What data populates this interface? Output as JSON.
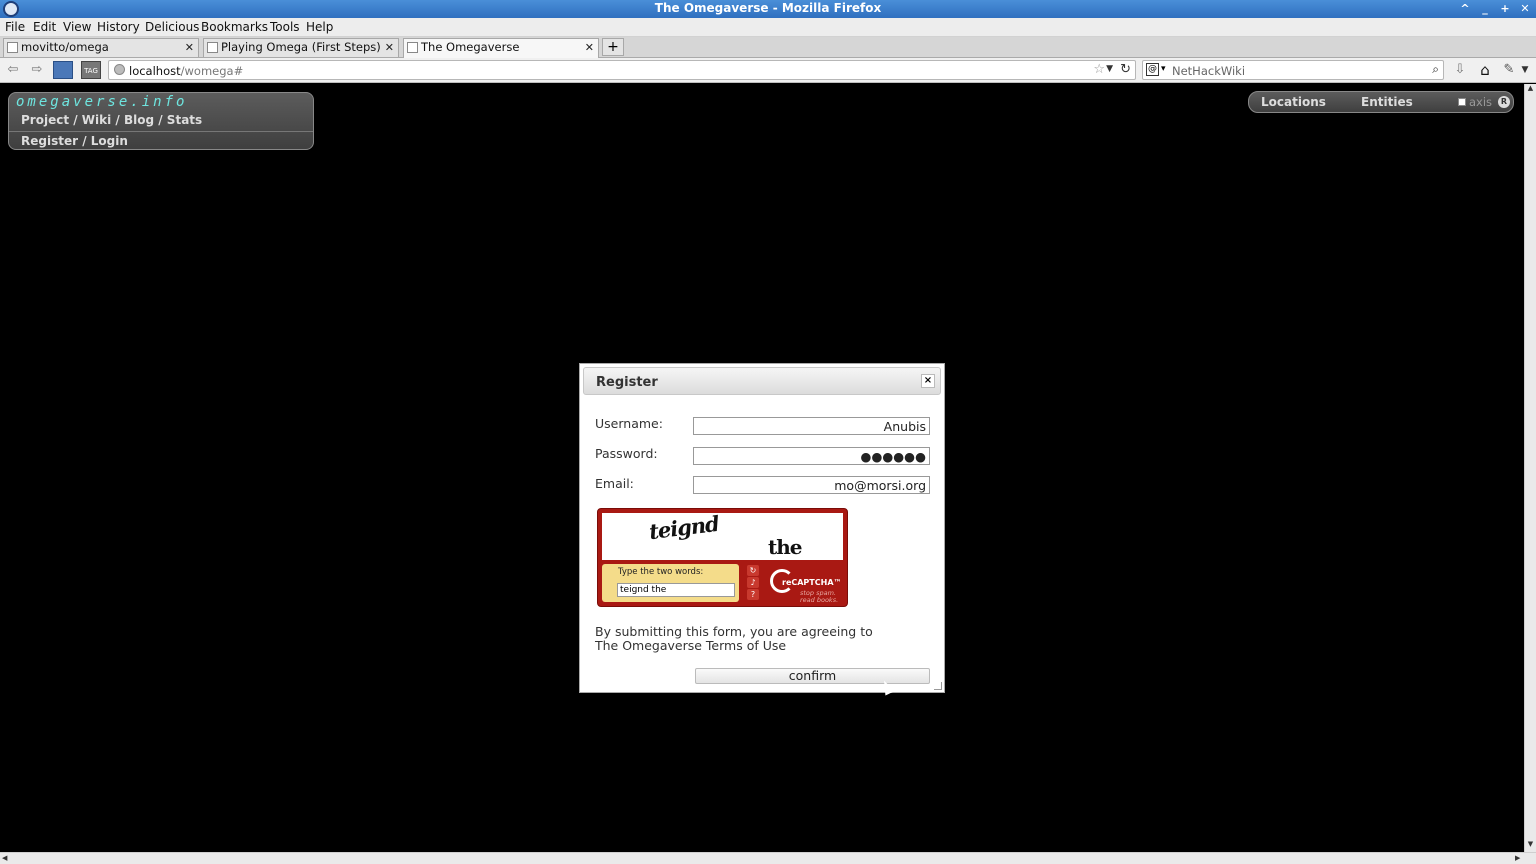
{
  "window": {
    "title": "The Omegaverse - Mozilla Firefox"
  },
  "menu": [
    "File",
    "Edit",
    "View",
    "History",
    "Delicious",
    "Bookmarks",
    "Tools",
    "Help"
  ],
  "tabs": [
    {
      "label": "movitto/omega",
      "active": false
    },
    {
      "label": "Playing Omega (First Steps)",
      "active": false
    },
    {
      "label": "The Omegaverse",
      "active": true
    }
  ],
  "newtab_label": "+",
  "urlbar": {
    "host": "localhost",
    "path": "/womega#"
  },
  "searchbar": {
    "placeholder": "NetHackWiki"
  },
  "site": {
    "brand": "omegaverse.info",
    "links": "Project / Wiki / Blog / Stats",
    "login": "Register / Login"
  },
  "rightpanel": {
    "locations": "Locations",
    "entities": "Entities",
    "axis": "axis"
  },
  "dialog": {
    "title": "Register",
    "close": "×",
    "username_label": "Username:",
    "username_value": "Anubis",
    "password_label": "Password:",
    "password_value": "●●●●●●",
    "email_label": "Email:",
    "email_value": "mo@morsi.org",
    "captcha": {
      "word1": "teignd",
      "word2": "the",
      "prompt": "Type the two words:",
      "answer": "teignd the",
      "brand": "reCAPTCHA™",
      "tagline1": "stop spam.",
      "tagline2": "read books."
    },
    "terms": "By submitting this form, you are agreeing to The Omegaverse Terms of Use",
    "confirm": "confirm"
  }
}
